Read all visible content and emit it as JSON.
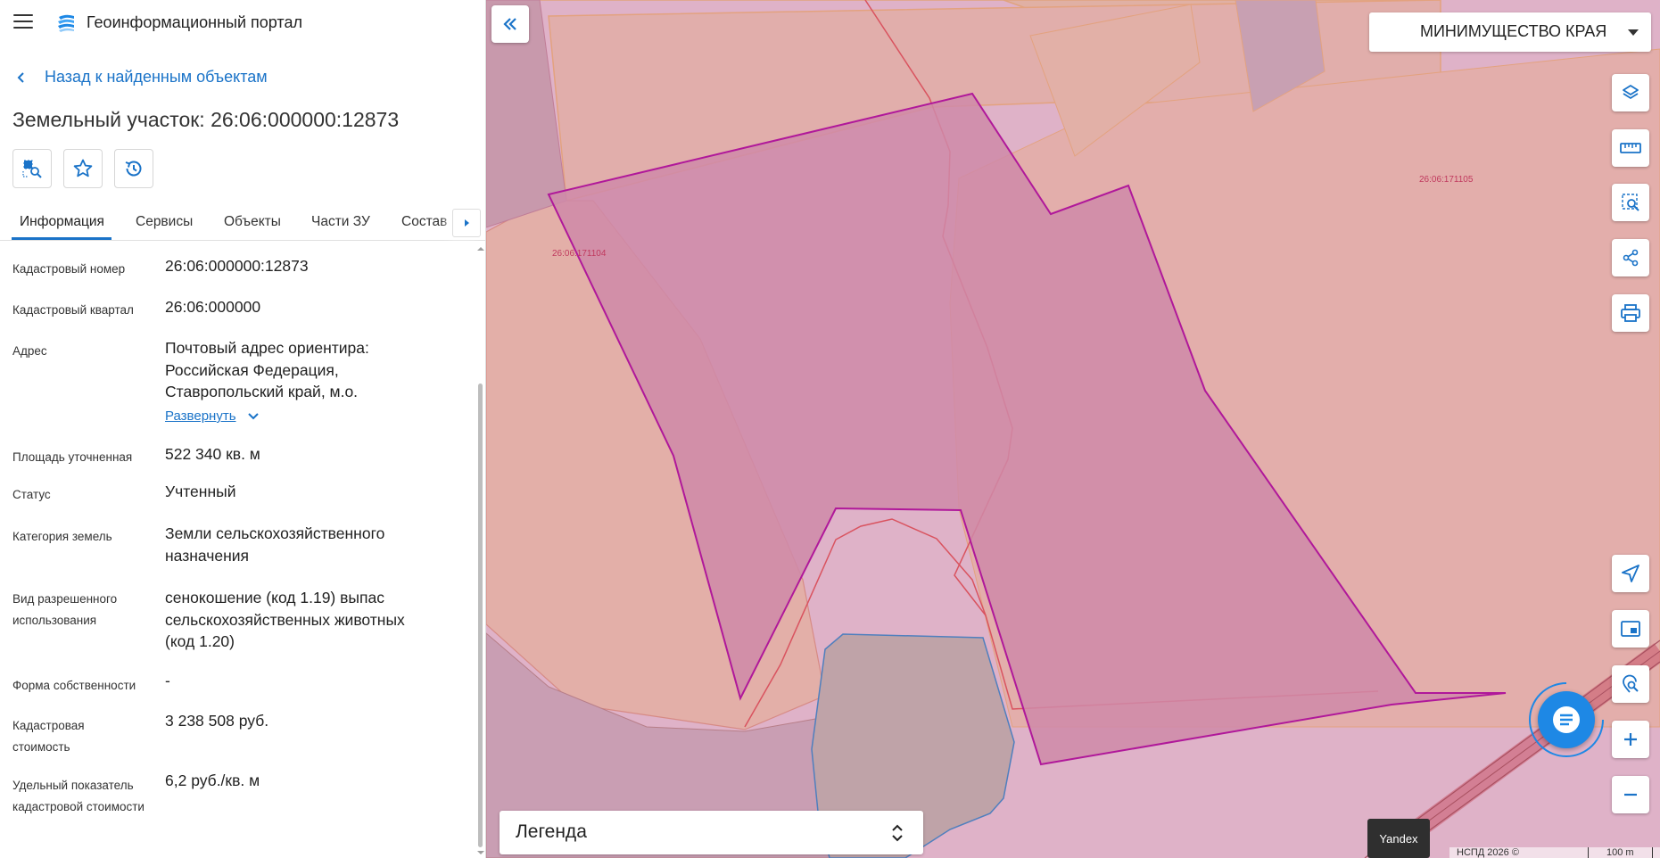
{
  "header": {
    "menu_icon": "hamburger-menu-icon",
    "logo_icon": "portal-logo-icon",
    "title": "Геоинформационный портал"
  },
  "back_link": {
    "label": "Назад к найденным объектам"
  },
  "object": {
    "title": "Земельный участок: 26:06:000000:12873"
  },
  "actions": [
    {
      "name": "locate-on-map-button",
      "icon": "search-area-icon"
    },
    {
      "name": "favorite-button",
      "icon": "star-icon"
    },
    {
      "name": "history-button",
      "icon": "history-icon"
    }
  ],
  "tabs": [
    {
      "label": "Информация",
      "active": true
    },
    {
      "label": "Сервисы",
      "active": false
    },
    {
      "label": "Объекты",
      "active": false
    },
    {
      "label": "Части ЗУ",
      "active": false
    },
    {
      "label": "Состав",
      "active": false
    }
  ],
  "info": {
    "cad_number": {
      "label": "Кадастровый номер",
      "value": "26:06:000000:12873"
    },
    "cad_quarter": {
      "label": "Кадастровый квартал",
      "value": "26:06:000000"
    },
    "address": {
      "label": "Адрес",
      "value": "Почтовый адрес ориентира: Российская Федерация, Ставропольский край, м.о.",
      "expand_label": "Развернуть"
    },
    "area": {
      "label": "Площадь уточненная",
      "value": "522 340 кв. м"
    },
    "status": {
      "label": "Статус",
      "value": "Учтенный"
    },
    "category": {
      "label": "Категория земель",
      "value": "Земли сельскохозяйственного назначения"
    },
    "usage": {
      "label": "Вид разрешенного использования",
      "value": "сенокошение (код 1.19) выпас сельскохозяйственных животных (код 1.20)"
    },
    "ownership": {
      "label": "Форма собственности",
      "value": "-"
    },
    "cad_cost": {
      "label": "Кадастровая стоимость",
      "value": "3 238 508 руб."
    },
    "unit_cost": {
      "label": "Удельный показатель кадастровой стоимости",
      "value": "6,2 руб./кв. м"
    }
  },
  "map": {
    "layer_select": "МИНИМУЩЕСТВО КРАЯ",
    "quarter_labels": [
      "26:06:171104",
      "26:06:171105"
    ],
    "legend_label": "Легенда",
    "tooltip": "Yandex",
    "attribution": "НСПД 2026 ©",
    "scale": "100 m",
    "tools": [
      "layers-icon",
      "ruler-icon",
      "select-area-icon",
      "share-icon",
      "print-icon",
      "navigate-icon",
      "minimap-icon",
      "location-search-icon",
      "zoom-in-icon",
      "zoom-out-icon"
    ],
    "colors": {
      "parcel_highlight": "#b0189a",
      "quarter_border": "#d7505f",
      "water_border": "#4f7fbe",
      "accent": "#1a73c8"
    }
  }
}
